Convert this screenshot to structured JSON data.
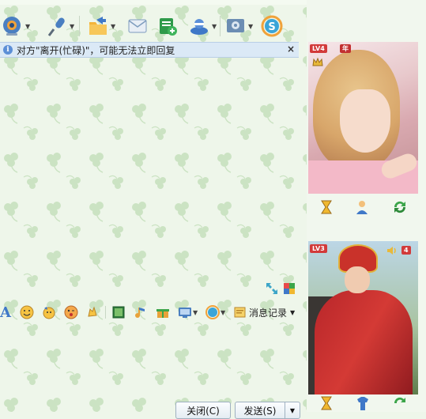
{
  "toolbar": {
    "items": [
      {
        "icon": "video-call-icon",
        "has_dropdown": true
      },
      {
        "icon": "microphone-icon",
        "has_dropdown": true
      },
      {
        "icon": "folder-transfer-icon",
        "has_dropdown": true
      },
      {
        "icon": "image-send-icon",
        "has_dropdown": false
      },
      {
        "icon": "add-contact-icon",
        "has_dropdown": false
      },
      {
        "icon": "remote-assist-icon",
        "has_dropdown": true
      },
      {
        "icon": "settings-icon",
        "has_dropdown": true
      },
      {
        "icon": "soso-icon",
        "has_dropdown": false
      }
    ]
  },
  "notice": {
    "text": "对方\"离开(忙碌)\"，可能无法立即回复",
    "close_label": "×"
  },
  "contact_photo": {
    "level_badge": "LV4",
    "extra_badge": "年"
  },
  "self_photo": {
    "level_badge": "LV3",
    "volume_badge": "4"
  },
  "format_bar": {
    "font_label": "A",
    "items": [
      {
        "icon": "emoji-icon"
      },
      {
        "icon": "magic-emoji-icon"
      },
      {
        "icon": "wink-emoji-icon"
      },
      {
        "icon": "shake-icon"
      },
      {
        "icon": "screenshot-icon"
      },
      {
        "icon": "music-icon"
      },
      {
        "icon": "gift-icon"
      },
      {
        "icon": "screen-capture-icon"
      },
      {
        "icon": "soso-small-icon"
      },
      {
        "icon": "message-history-icon"
      }
    ],
    "message_record_label": "消息记录"
  },
  "buttons": {
    "close_label": "关闭(C)",
    "send_label": "发送(S)",
    "send_dropdown": "▼"
  },
  "colors": {
    "background": "#eef6ea",
    "notice_bg": "#dbe9f6",
    "accent_blue": "#4a7fc1",
    "clover": "#bcd9b0"
  }
}
